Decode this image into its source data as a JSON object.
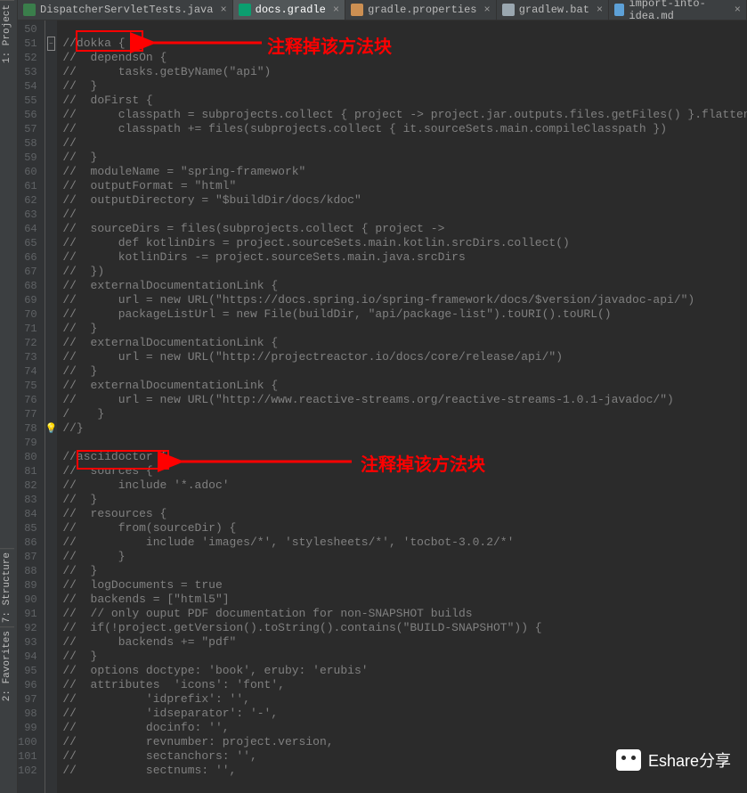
{
  "tool_windows": {
    "project": "1: Project",
    "structure": "7: Structure",
    "favorites": "2: Favorites"
  },
  "tabs": [
    {
      "label": "DispatcherServletTests.java",
      "icon": "#3a7e4b",
      "active": false
    },
    {
      "label": "docs.gradle",
      "icon": "#0b9e6f",
      "active": true
    },
    {
      "label": "gradle.properties",
      "icon": "#cc8f52",
      "active": false
    },
    {
      "label": "gradlew.bat",
      "icon": "#9aa7b0",
      "active": false
    },
    {
      "label": "import-into-idea.md",
      "icon": "#5da1d8",
      "active": false
    }
  ],
  "gutter_start": 50,
  "lines": [
    "",
    "//dokka {",
    "//  dependsOn {",
    "//      tasks.getByName(\"api\")",
    "//  }",
    "//  doFirst {",
    "//      classpath = subprojects.collect { project -> project.jar.outputs.files.getFiles() }.flatten()",
    "//      classpath += files(subprojects.collect { it.sourceSets.main.compileClasspath })",
    "//",
    "//  }",
    "//  moduleName = \"spring-framework\"",
    "//  outputFormat = \"html\"",
    "//  outputDirectory = \"$buildDir/docs/kdoc\"",
    "//",
    "//  sourceDirs = files(subprojects.collect { project ->",
    "//      def kotlinDirs = project.sourceSets.main.kotlin.srcDirs.collect()",
    "//      kotlinDirs -= project.sourceSets.main.java.srcDirs",
    "//  })",
    "//  externalDocumentationLink {",
    "//      url = new URL(\"https://docs.spring.io/spring-framework/docs/$version/javadoc-api/\")",
    "//      packageListUrl = new File(buildDir, \"api/package-list\").toURI().toURL()",
    "//  }",
    "//  externalDocumentationLink {",
    "//      url = new URL(\"http://projectreactor.io/docs/core/release/api/\")",
    "//  }",
    "//  externalDocumentationLink {",
    "//      url = new URL(\"http://www.reactive-streams.org/reactive-streams-1.0.1-javadoc/\")",
    "/    }",
    "//}",
    "",
    "//asciidoctor {",
    "//  sources {",
    "//      include '*.adoc'",
    "//  }",
    "//  resources {",
    "//      from(sourceDir) {",
    "//          include 'images/*', 'stylesheets/*', 'tocbot-3.0.2/*'",
    "//      }",
    "//  }",
    "//  logDocuments = true",
    "//  backends = [\"html5\"]",
    "//  // only ouput PDF documentation for non-SNAPSHOT builds",
    "//  if(!project.getVersion().toString().contains(\"BUILD-SNAPSHOT\")) {",
    "//      backends += \"pdf\"",
    "//  }",
    "//  options doctype: 'book', eruby: 'erubis'",
    "//  attributes  'icons': 'font',",
    "//          'idprefix': '',",
    "//          'idseparator': '-',",
    "//          docinfo: '',",
    "//          revnumber: project.version,",
    "//          sectanchors: '',",
    "//          sectnums: '',"
  ],
  "annotations": {
    "top": "注释掉该方法块",
    "bottom": "注释掉该方法块"
  },
  "watermark": "Eshare分享"
}
